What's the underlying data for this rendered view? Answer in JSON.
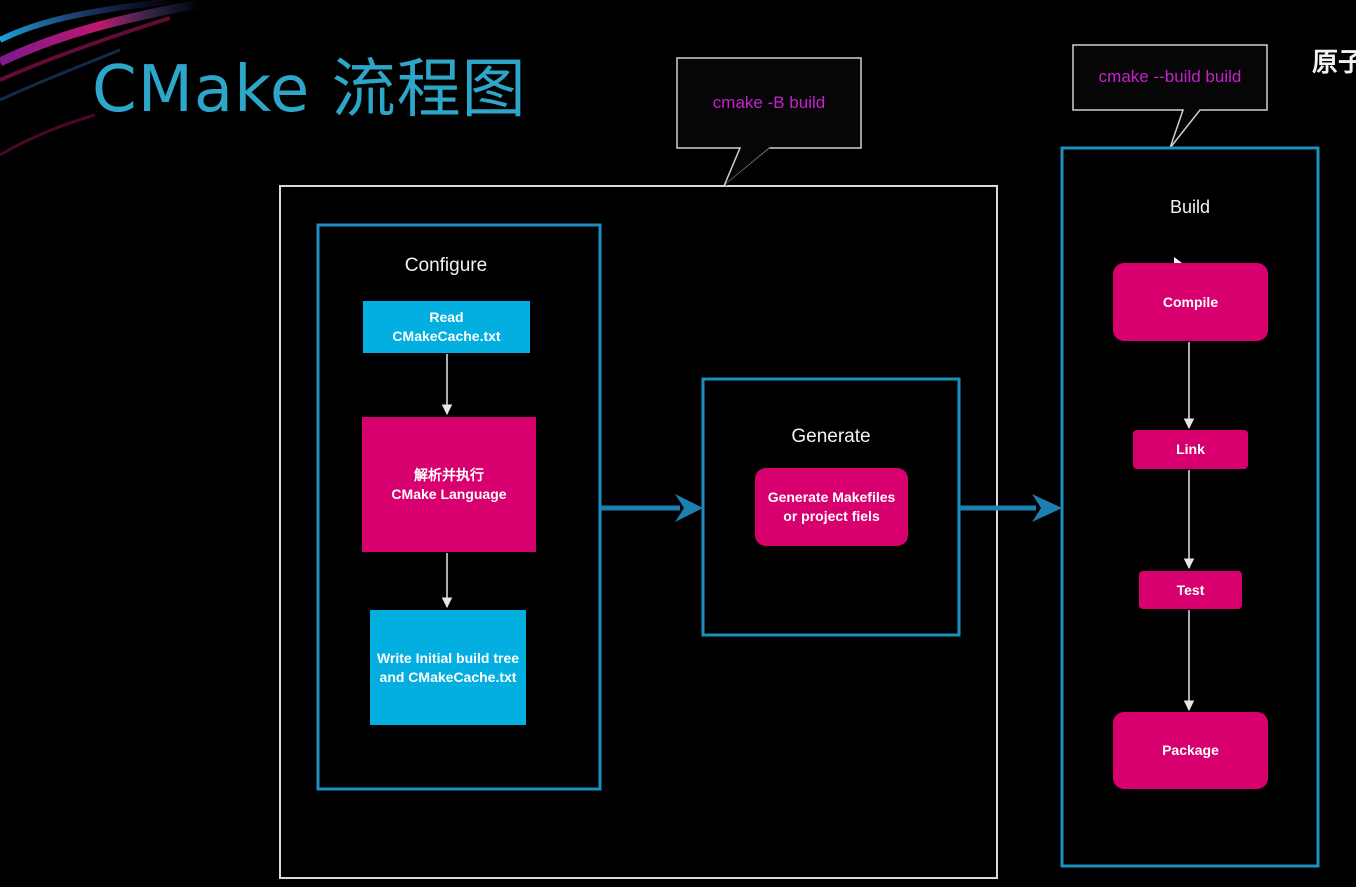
{
  "slide": {
    "title": "CMake 流程图",
    "corner_text": "原子"
  },
  "callouts": {
    "configure_command": "cmake -B build",
    "build_command": "cmake --build build"
  },
  "groups": {
    "configure": {
      "label": "Configure",
      "steps": [
        "Read\nCMakeCache.txt",
        "解析并执行\nCMake Language",
        "Write Initial build tree\nand CMakeCache.txt"
      ]
    },
    "generate": {
      "label": "Generate",
      "steps": [
        "Generate Makefiles\nor project fiels"
      ]
    },
    "build": {
      "label": "Build",
      "steps": [
        "Compile",
        "Link",
        "Test",
        "Package"
      ]
    }
  },
  "colors": {
    "title": "#2ea6c9",
    "callout_text": "#c81fd0",
    "frame_blue": "#1a8fc0",
    "outer_frame": "#d9d9d9",
    "step_blue": "#03aee0",
    "step_pink": "#d8006e",
    "flow_arrow": "#1c7fb0"
  }
}
